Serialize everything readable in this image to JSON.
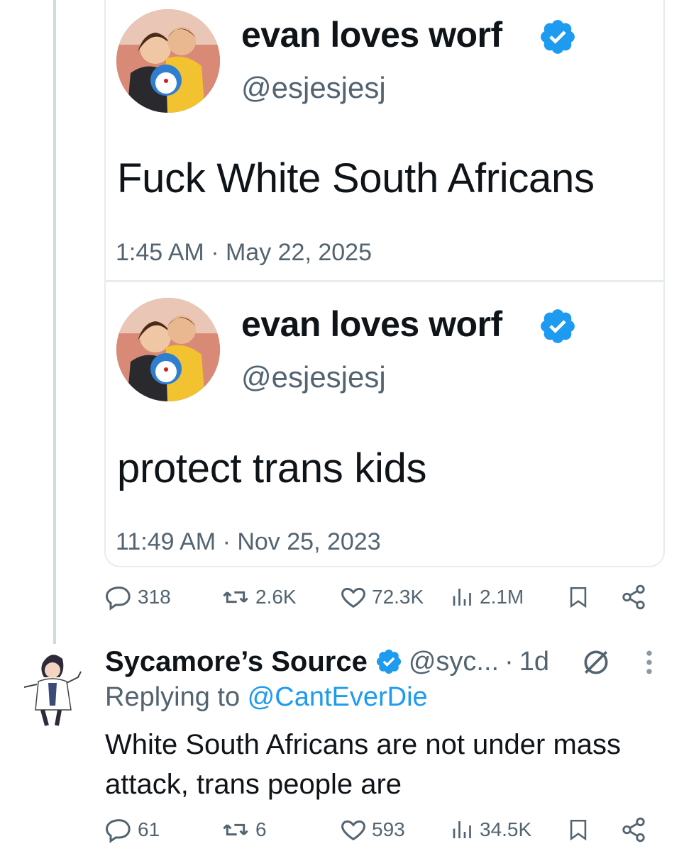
{
  "quoted_tweet": {
    "author_name": "evan loves worf",
    "handle": "@esjesjesj",
    "text": "Fuck White South Africans",
    "time": "1:45 AM · May 22, 2025",
    "stats": {
      "replies": "318",
      "reposts": "2.6K",
      "likes": "72.3K",
      "views": "2.1M"
    }
  },
  "nested_quote": {
    "author_name": "evan loves worf",
    "handle": "@esjesjesj",
    "text": "protect trans kids",
    "time": "11:49 AM · Nov 25, 2023"
  },
  "reply": {
    "author_name": "Sycamore’s Source",
    "handle": "@syc...",
    "separator": "·",
    "age": "1d",
    "replying_prefix": "Replying to ",
    "replying_to": "@CantEverDie",
    "text": "White South Africans are not under mass attack, trans people are",
    "stats": {
      "replies": "61",
      "reposts": "6",
      "likes": "593",
      "views": "34.5K"
    }
  },
  "colors": {
    "verified": "#1d9bf0",
    "muted": "#536471",
    "link": "#1d9bf0"
  },
  "icons": [
    "verified-badge-icon",
    "reply-icon",
    "repost-icon",
    "like-icon",
    "views-icon",
    "bookmark-icon",
    "share-icon",
    "grok-icon",
    "more-icon"
  ]
}
